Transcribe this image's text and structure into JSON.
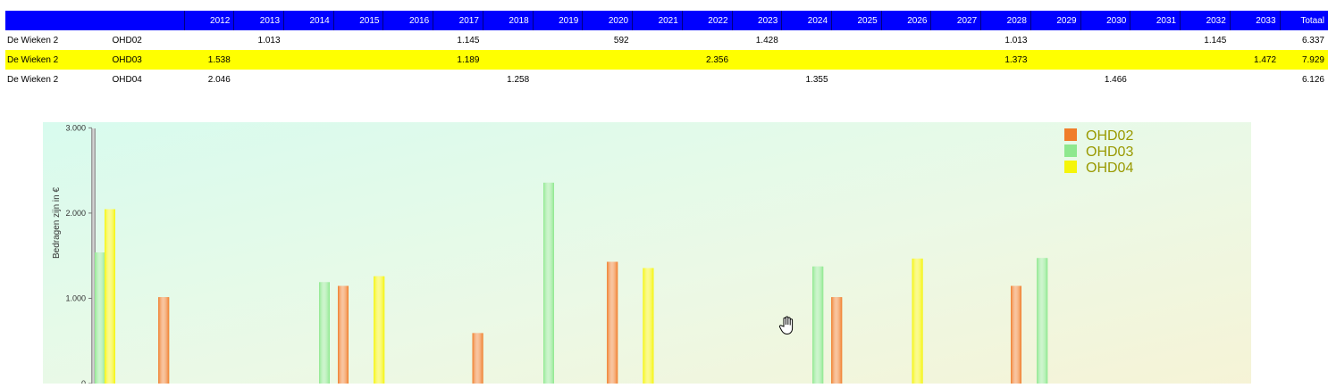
{
  "table": {
    "columns": [
      "",
      "",
      "2012",
      "2013",
      "2014",
      "2015",
      "2016",
      "2017",
      "2018",
      "2019",
      "2020",
      "2021",
      "2022",
      "2023",
      "2024",
      "2025",
      "2026",
      "2027",
      "2028",
      "2029",
      "2030",
      "2031",
      "2032",
      "2033",
      "Totaal"
    ],
    "rows": [
      {
        "name": "De Wieken 2",
        "code": "OHD02",
        "cells": [
          "",
          "1.013",
          "",
          "",
          "",
          "1.145",
          "",
          "",
          "592",
          "",
          "",
          "1.428",
          "",
          "",
          "",
          "",
          "1.013",
          "",
          "",
          "",
          "1.145",
          "",
          "6.337"
        ],
        "highlight": false
      },
      {
        "name": "De Wieken 2",
        "code": "OHD03",
        "cells": [
          "1.538",
          "",
          "",
          "",
          "",
          "1.189",
          "",
          "",
          "",
          "",
          "2.356",
          "",
          "",
          "",
          "",
          "",
          "1.373",
          "",
          "",
          "",
          "",
          "1.472",
          "7.929"
        ],
        "highlight": true
      },
      {
        "name": "De Wieken 2",
        "code": "OHD04",
        "cells": [
          "2.046",
          "",
          "",
          "",
          "",
          "",
          "1.258",
          "",
          "",
          "",
          "",
          "",
          "1.355",
          "",
          "",
          "",
          "",
          "",
          "1.466",
          "",
          "",
          "",
          "6.126"
        ],
        "highlight": false
      }
    ]
  },
  "colors": {
    "header_bg": "#0000ff",
    "highlight_row": "#ffff00",
    "OHD02": "#f07d2a",
    "OHD03": "#8ee88e",
    "OHD04": "#f5f50a",
    "legend_text": "#999900"
  },
  "chart_data": {
    "type": "bar",
    "ylabel": "Bedragen zijn in €",
    "yticks": [
      "0",
      "1.000",
      "2.000",
      "3.000"
    ],
    "ylim": [
      0,
      3000
    ],
    "grid": false,
    "legend": "top-right",
    "series": [
      {
        "name": "OHD02",
        "x": [
          2013,
          2017,
          2020,
          2023,
          2028,
          2032
        ],
        "values": [
          1013,
          1145,
          592,
          1428,
          1013,
          1145
        ]
      },
      {
        "name": "OHD03",
        "x": [
          2012,
          2017,
          2022,
          2028,
          2033
        ],
        "values": [
          1538,
          1189,
          2356,
          1373,
          1472
        ]
      },
      {
        "name": "OHD04",
        "x": [
          2012,
          2018,
          2024,
          2030
        ],
        "values": [
          2046,
          1258,
          1355,
          1466
        ]
      }
    ]
  }
}
